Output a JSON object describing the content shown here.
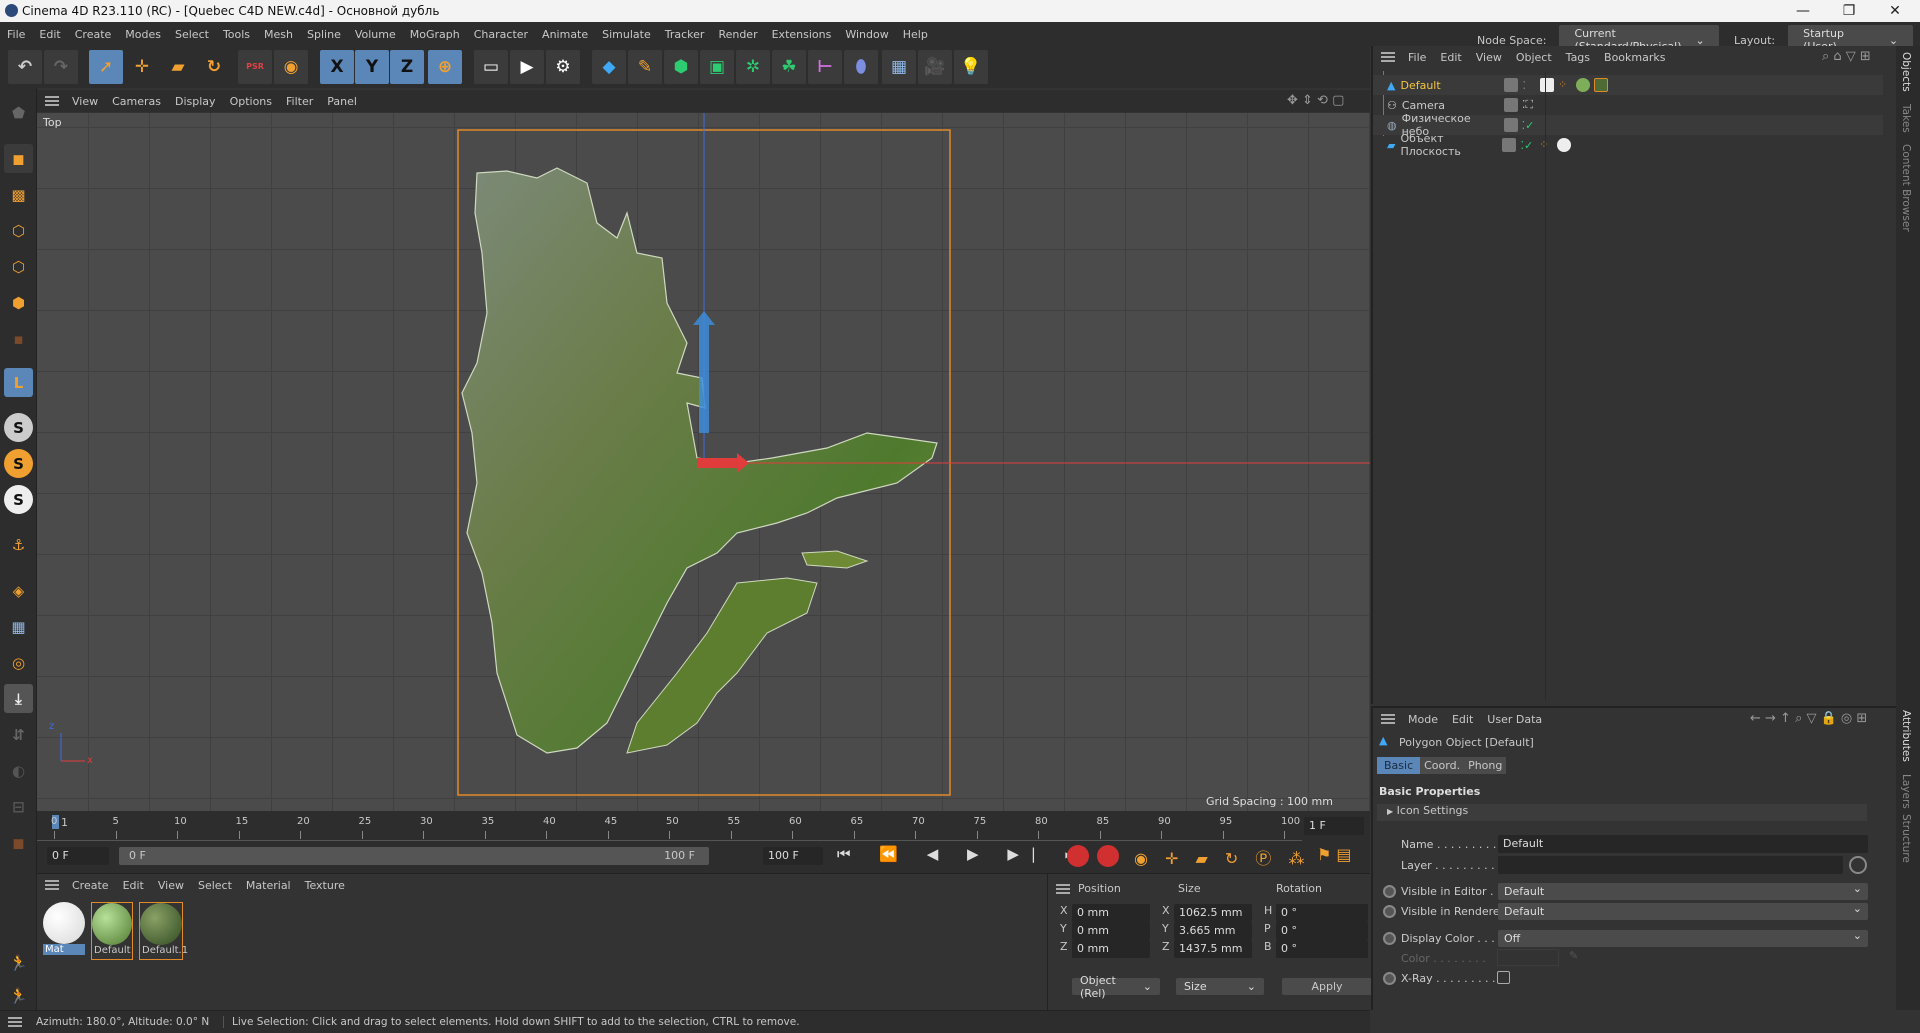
{
  "window": {
    "title": "Cinema 4D R23.110 (RC) - [Quebec C4D NEW.c4d] - Основной дубль",
    "minimize": "—",
    "maximize": "❐",
    "close": "✕"
  },
  "menu": [
    "File",
    "Edit",
    "Create",
    "Modes",
    "Select",
    "Tools",
    "Mesh",
    "Spline",
    "Volume",
    "MoGraph",
    "Character",
    "Animate",
    "Simulate",
    "Tracker",
    "Render",
    "Extensions",
    "Window",
    "Help"
  ],
  "node_space": {
    "label": "Node Space:",
    "value": "Current (Standard/Physical)"
  },
  "layout": {
    "label": "Layout:",
    "value": "Startup (User)"
  },
  "toolbar": {
    "x": "X",
    "y": "Y",
    "z": "Z",
    "psr": "PSR"
  },
  "viewport": {
    "menu": [
      "View",
      "Cameras",
      "Display",
      "Options",
      "Filter",
      "Panel"
    ],
    "camera_label": "Top",
    "grid_spacing": "Grid Spacing : 100 mm",
    "axis_x": "x",
    "axis_z": "z"
  },
  "timeline": {
    "ticks": [
      "0",
      "5",
      "10",
      "15",
      "20",
      "25",
      "30",
      "35",
      "40",
      "45",
      "50",
      "55",
      "60",
      "65",
      "70",
      "75",
      "80",
      "85",
      "90",
      "95",
      "100"
    ],
    "current_frame_marker": "1",
    "current_frame": "1 F",
    "start": "0 F",
    "range_start": "0 F",
    "range_end": "100 F",
    "end": "100 F"
  },
  "materials": {
    "menu": [
      "Create",
      "Edit",
      "View",
      "Select",
      "Material",
      "Texture"
    ],
    "items": [
      {
        "name": "Mat",
        "color": "#f2f2f2"
      },
      {
        "name": "Default",
        "color": "#7fae5a"
      },
      {
        "name": "Default.1",
        "color": "#4e6a35"
      }
    ]
  },
  "coords": {
    "headers": {
      "position": "Position",
      "size": "Size",
      "rotation": "Rotation"
    },
    "rows": [
      {
        "axis": "X",
        "pos": "0 mm",
        "size_axis": "X",
        "size": "1062.5 mm",
        "rot_axis": "H",
        "rot": "0 °"
      },
      {
        "axis": "Y",
        "pos": "0 mm",
        "size_axis": "Y",
        "size": "3.665 mm",
        "rot_axis": "P",
        "rot": "0 °"
      },
      {
        "axis": "Z",
        "pos": "0 mm",
        "size_axis": "Z",
        "size": "1437.5 mm",
        "rot_axis": "B",
        "rot": "0 °"
      }
    ],
    "mode": "Object (Rel)",
    "size_mode": "Size",
    "apply": "Apply"
  },
  "status": {
    "left": "Azimuth: 180.0°, Altitude: 0.0°  N",
    "message": "Live Selection: Click and drag to select elements. Hold down SHIFT to add to the selection, CTRL to remove."
  },
  "objects": {
    "menu": [
      "File",
      "Edit",
      "View",
      "Object",
      "Tags",
      "Bookmarks"
    ],
    "items": [
      {
        "name": "Default",
        "selected": true
      },
      {
        "name": "Camera"
      },
      {
        "name": "Физическое небо"
      },
      {
        "name": "Объект Плоскость"
      }
    ]
  },
  "attributes": {
    "menu": [
      "Mode",
      "Edit",
      "User Data"
    ],
    "title": "Polygon Object [Default]",
    "tabs": [
      "Basic",
      "Coord.",
      "Phong"
    ],
    "section": "Basic Properties",
    "icon_settings": "Icon Settings",
    "name_label": "Name . . . . . . . . .",
    "name_value": "Default",
    "layer_label": "Layer . . . . . . . . .",
    "visible_editor_label": "Visible in Editor . .",
    "visible_editor": "Default",
    "visible_renderer_label": "Visible in Renderer",
    "visible_renderer": "Default",
    "display_color_label": "Display Color . . . .",
    "display_color": "Off",
    "color_label": "Color . . . . . . . .",
    "xray_label": "X-Ray . . . . . . . . .",
    "xray": false
  },
  "side_tabs": [
    "Objects",
    "Takes",
    "Content Browser",
    "Attributes",
    "Layers",
    "Structure"
  ],
  "colors": {
    "accent": "#5b87b8",
    "orange": "#f0a030",
    "selected_text": "#f5c542",
    "frame": "#e08a2a"
  }
}
